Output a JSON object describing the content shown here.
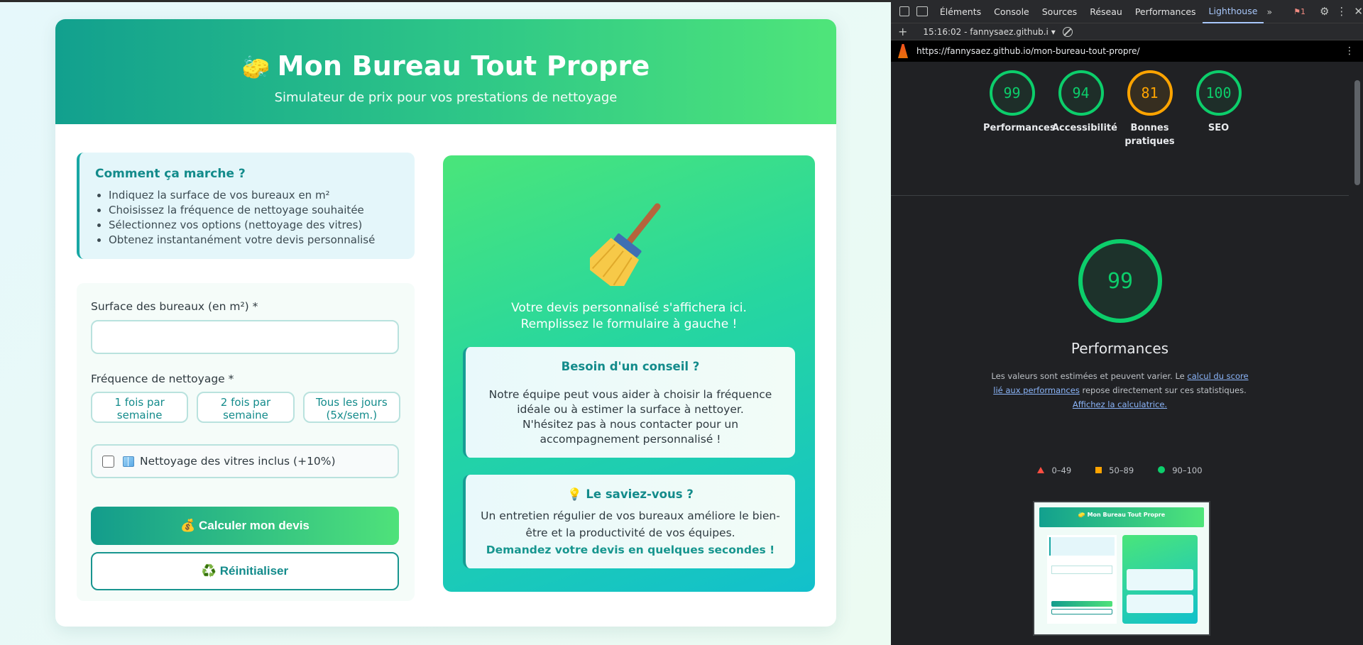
{
  "site": {
    "title": "Mon Bureau Tout Propre",
    "subtitle": "Simulateur de prix pour vos prestations de nettoyage",
    "howto": {
      "title": "Comment ça marche ?",
      "steps": [
        "Indiquez la surface de vos bureaux en m²",
        "Choisissez la fréquence de nettoyage souhaitée",
        "Sélectionnez vos options (nettoyage des vitres)",
        "Obtenez instantanément votre devis personnalisé"
      ]
    },
    "form": {
      "surface_label": "Surface des bureaux (en m²) *",
      "surface_value": "",
      "frequency_label": "Fréquence de nettoyage *",
      "frequency_options": [
        "1 fois par semaine",
        "2 fois par semaine",
        "Tous les jours (5x/sem.)"
      ],
      "windows_label": "Nettoyage des vitres inclus (+10%)",
      "windows_checked": false,
      "calculate_label": "💰 Calculer mon devis",
      "reset_label": "♻️ Réinitialiser"
    },
    "result": {
      "placeholder_line1": "Votre devis personnalisé s'affichera ici.",
      "placeholder_line2": "Remplissez le formulaire à gauche !",
      "advice_title": "Besoin d'un conseil ?",
      "advice_text1": "Notre équipe peut vous aider à choisir la fréquence idéale ou à estimer la surface à nettoyer.",
      "advice_text2": "N'hésitez pas à nous contacter pour un accompagnement personnalisé !",
      "fact_title": "💡 Le saviez-vous ?",
      "fact_text": "Un entretien régulier de vos bureaux améliore le bien-être et la productivité de vos équipes.",
      "fact_cta": "Demandez votre devis en quelques secondes !"
    }
  },
  "devtools": {
    "tabs": [
      "Éléments",
      "Console",
      "Sources",
      "Réseau",
      "Performances",
      "Lighthouse"
    ],
    "active_tab": "Lighthouse",
    "issues_count": "1",
    "report_selector": "15:16:02 - fannysaez.github.i",
    "url": "https://fannysaez.github.io/mon-bureau-tout-propre/",
    "scores": [
      {
        "label": "Performances",
        "value": "99",
        "color": "#0cce6b"
      },
      {
        "label": "Accessibilité",
        "value": "94",
        "color": "#0cce6b"
      },
      {
        "label": "Bonnes pratiques",
        "value": "81",
        "color": "#ffa400"
      },
      {
        "label": "SEO",
        "value": "100",
        "color": "#0cce6b"
      }
    ],
    "main_score": "99",
    "main_title": "Performances",
    "desc_prefix": "Les valeurs sont estimées et peuvent varier. Le ",
    "desc_link1": "calcul du score lié aux performances",
    "desc_middle": " repose directement sur ces statistiques. ",
    "desc_link2": "Affichez la calculatrice.",
    "legend": [
      {
        "range": "0–49",
        "color": "#ff4e42"
      },
      {
        "range": "50–89",
        "color": "#ffa400"
      },
      {
        "range": "90–100",
        "color": "#0cce6b"
      }
    ],
    "thumbnail_title": "🧽 Mon Bureau Tout Propre"
  }
}
